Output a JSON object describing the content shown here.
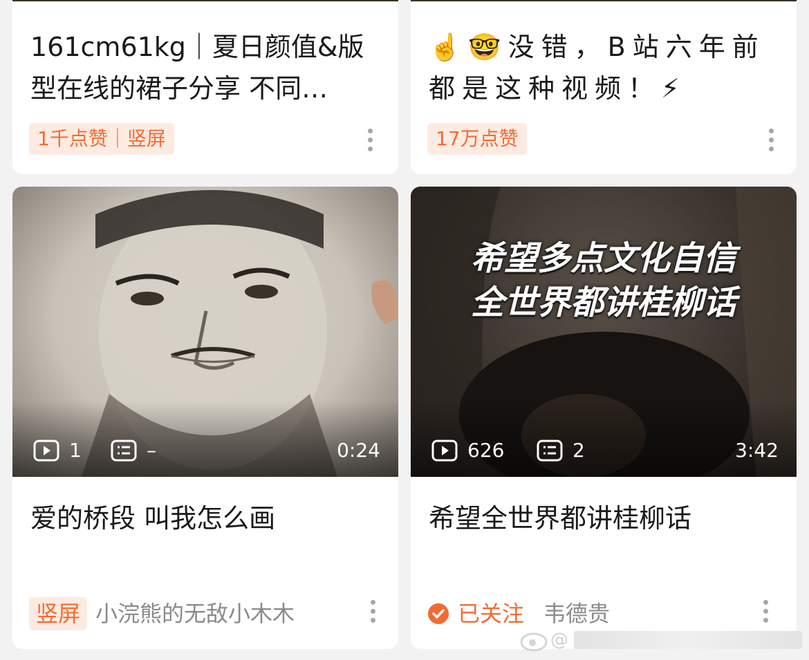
{
  "cards": [
    {
      "title": "161cm61kg｜夏日颜值&版型在线的裙子分享 不同…",
      "badge": "1千点赞｜竖屏",
      "more_icon": "more-vertical-icon"
    },
    {
      "title": "☝️🤓没错，B站六年前都是这种视频！⚡",
      "badge": "17万点赞",
      "more_icon": "more-vertical-icon"
    },
    {
      "title": "爱的桥段 叫我怎么画",
      "play_count": "1",
      "comment_count": "–",
      "duration": "0:24",
      "badge": "竖屏",
      "author": "小浣熊的无敌小木木",
      "more_icon": "more-vertical-icon"
    },
    {
      "title": "希望全世界都讲桂柳话",
      "overlay_line1": "希望多点文化自信",
      "overlay_line2": "全世界都讲桂柳话",
      "play_count": "626",
      "comment_count": "2",
      "duration": "3:42",
      "follow_label": "已关注",
      "author": "韦德贵",
      "more_icon": "more-vertical-icon"
    }
  ],
  "watermark": "@",
  "colors": {
    "accent": "#f26b32",
    "badge_bg": "#fdebe1",
    "page_bg": "#f2f2f2"
  }
}
